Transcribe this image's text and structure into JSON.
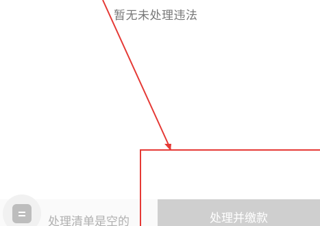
{
  "empty_state": {
    "message": "暂无未处理违法"
  },
  "bottom_bar": {
    "cart_text": "处理清单是空的",
    "pay_button_label": "处理并缴款",
    "list_icon": "list-icon"
  },
  "colors": {
    "annotation": "#e53935",
    "pay_button_bg": "#cfcfcf",
    "muted_text": "#b0b0b0"
  }
}
